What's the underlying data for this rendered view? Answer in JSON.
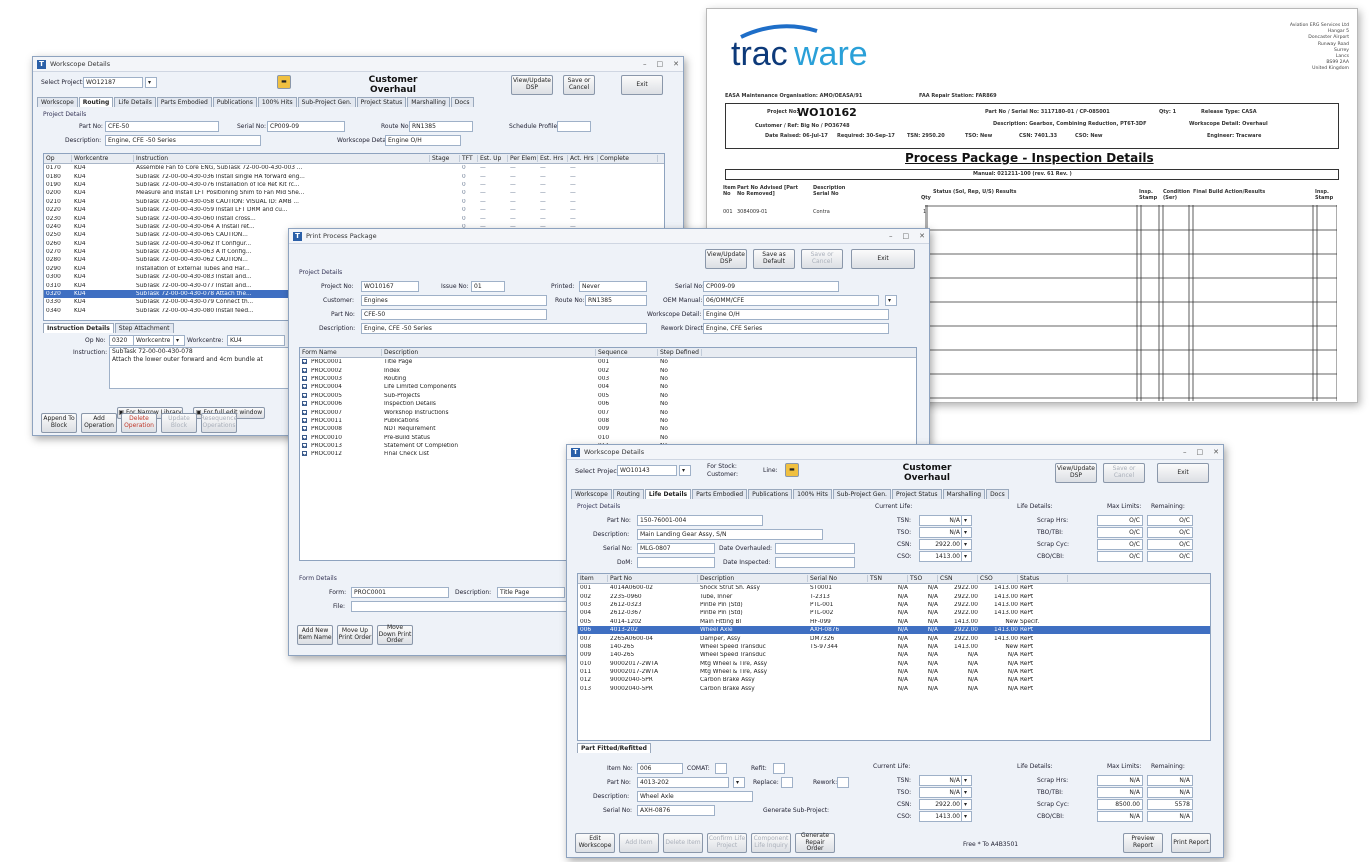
{
  "doc": {
    "logo_a": "trac",
    "logo_b": "ware",
    "company": [
      "Aviation ERG Services Ltd",
      "Hangar 5",
      "Doncaster Airport",
      "Runway Road",
      "Surrey",
      "Lancs",
      "BS99 2AA",
      "United Kingdom"
    ],
    "org_line": "EASA Maintenance Organisation: AMO/OEASA/91",
    "faa_line": "FAA Repair Station: FAR869",
    "project_label": "Project No:",
    "project_no": "WO10162",
    "customer": "Customer / Ref: Big No / PO36748",
    "date_raised": "Date Raised: 06-Jul-17",
    "required": "Required: 30-Sep-17",
    "part_serial": "Part No / Serial No: 3117180-01 / CP-085001",
    "description": "Description: Gearbox, Combining Reduction, PT6T-3DF",
    "tsn": "TSN: 2950.20",
    "tso": "TSO: New",
    "csn": "CSN: 7401.33",
    "cso": "CSO: New",
    "qty": "Qty: 1",
    "release_type": "Release Type: CASA",
    "workscope": "Workscope Detail: Overhaul",
    "engineer": "Engineer: Tracware",
    "heading": "Process Package - Inspection Details",
    "manual": "Manual: 021211-100 (rev. 61 Rev. )",
    "columns": [
      "Item No",
      "Part No Advised [Part No Removed]",
      "Description Serial No",
      "Qty",
      "Status (Sol, Rep, U/S) Results",
      "Insp. Stamp",
      "Condition (Ser)",
      "Final Build Action/Results",
      "Insp. Stamp"
    ],
    "row1": [
      "001",
      "3084009-01",
      "Contra",
      "1"
    ]
  },
  "win_routing": {
    "title": "Workscope Details",
    "select_project_label": "Select Project:",
    "select_project_value": "WO12187",
    "center_title": "Customer Overhaul",
    "btn_view": "View/Update DSP",
    "btn_save": "Save or Cancel",
    "btn_exit": "Exit",
    "tabs": [
      "Workscope",
      "Routing",
      "Life Details",
      "Parts Embodied",
      "Publications",
      "100% Hits",
      "Sub-Project Gen.",
      "Project Status",
      "Marshalling",
      "Docs"
    ],
    "active_tab": "Routing",
    "section": "Project Details",
    "part_no_label": "Part No:",
    "part_no": "CFE-50",
    "serial_label": "Serial No:",
    "serial": "CP009-09",
    "route_label": "Route No:",
    "route": "RN1385",
    "schedule_label": "Schedule Profile:",
    "description_label": "Description:",
    "description": "Engine, CFE -50 Series",
    "workscope_label": "Workscope Detail:",
    "workscope": "Engine O/H",
    "columns": [
      "Op",
      "Workcentre",
      "Instruction",
      "Stage",
      "TFT",
      "Est. Up",
      "Per Elem",
      "Est. Hrs",
      "Act. Hrs",
      "Complete"
    ],
    "rows": [
      [
        "0170",
        "KU4",
        "Assemble Fan to Core ENG, SubTask 72-00-00-430-003 ..."
      ],
      [
        "0180",
        "KU4",
        "SubTask 72-00-00-430-036 Install single HA forward eng..."
      ],
      [
        "0190",
        "KU4",
        "SubTask 72-00-00-430-076 Installation of Ice Ret Kit rc..."
      ],
      [
        "0200",
        "KU4",
        "Measure and Install LFT Positioning Shim to Fan Mid She..."
      ],
      [
        "0210",
        "KU4",
        "SubTask 72-00-00-430-058 CAUTION: VISUAL ID: AMB ..."
      ],
      [
        "0220",
        "KU4",
        "SubTask 72-00-00-430-059 Install LFT DRM and cu..."
      ],
      [
        "0230",
        "KU4",
        "SubTask 72-00-00-430-060 Install cross..."
      ],
      [
        "0240",
        "KU4",
        "SubTask 72-00-00-430-064 A Install ret..."
      ],
      [
        "0250",
        "KU4",
        "SubTask 72-00-00-430-065 CAUTION..."
      ],
      [
        "0260",
        "KU4",
        "SubTask 72-00-00-430-062 If Configur..."
      ],
      [
        "0270",
        "KU4",
        "SubTask 72-00-00-430-063 A If Config..."
      ],
      [
        "0280",
        "KU4",
        "SubTask 72-00-00-430-062 CAUTION..."
      ],
      [
        "0290",
        "KU4",
        "Installation of External Tubes and Har..."
      ],
      [
        "0300",
        "KU4",
        "SubTask 72-00-00-430-083 Install and..."
      ],
      [
        "0310",
        "KU4",
        "SubTask 72-00-00-430-077 Install and..."
      ],
      [
        "0320",
        "KU4",
        "SubTask 72-00-00-430-078 Attach the..."
      ],
      [
        "0330",
        "KU4",
        "SubTask 72-00-00-430-079 Connect th..."
      ],
      [
        "0340",
        "KU4",
        "SubTask 72-00-00-430-080 Install feed..."
      ]
    ],
    "status_vals": [
      "0",
      "—",
      "—",
      "—",
      "—"
    ],
    "sub_tabs": [
      "Instruction Details",
      "Step Attachment"
    ],
    "op_label": "Op No:",
    "op_value": "0320",
    "op_type": "Workcentre",
    "wc_label": "Workcentre:",
    "wc_value": "KU4",
    "instr_label": "Instruction:",
    "instr_1": "SubTask 72-00-00-430-078",
    "instr_2": "Attach the lower outer forward and 4cm bundle at",
    "lib_btn": "For Narrow Library",
    "edit_btn": "For full edit window",
    "bottom_btns": [
      "Append To Block",
      "Add Operation",
      "Delete Operation",
      "Update Block",
      "Resequence Operations"
    ]
  },
  "win_print": {
    "title": "Print Process Package",
    "btn_view": "View/Update DSP",
    "btn_default": "Save as Default",
    "btn_cancel": "Save or Cancel",
    "btn_exit": "Exit",
    "section": "Project Details",
    "project_label": "Project No:",
    "project": "WO10167",
    "issue_label": "Issue No:",
    "issue": "01",
    "printed_label": "Printed:",
    "printed": "Never",
    "serial_label": "Serial No:",
    "serial": "CP009-09",
    "customer_label": "Customer:",
    "customer": "Engines",
    "route_label": "Route No:",
    "route": "RN1385",
    "oem_label": "OEM Manual:",
    "oem": "06/OMM/CFE",
    "part_label": "Part No:",
    "part": "CFE-50",
    "workscope_label": "Workscope Detail:",
    "workscope": "Engine O/H",
    "desc_label": "Description:",
    "desc": "Engine, CFE -50 Series",
    "rework_label": "Rework Direct:",
    "rework": "Engine, CFE Series",
    "columns": [
      "Form Name",
      "Description",
      "Sequence",
      "Step Defined"
    ],
    "rows": [
      [
        "PROC0001",
        "Title Page",
        "001",
        "No"
      ],
      [
        "PROC0002",
        "Index",
        "002",
        "No"
      ],
      [
        "PROC0003",
        "Routing",
        "003",
        "No"
      ],
      [
        "PROC0004",
        "Life Limited Components",
        "004",
        "No"
      ],
      [
        "PROC0005",
        "Sub-Projects",
        "005",
        "No"
      ],
      [
        "PROC0006",
        "Inspection Details",
        "006",
        "No"
      ],
      [
        "PROC0007",
        "Workshop Instructions",
        "007",
        "No"
      ],
      [
        "PROC0011",
        "Publications",
        "008",
        "No"
      ],
      [
        "PROC0008",
        "NDT Requirement",
        "009",
        "No"
      ],
      [
        "PROC0010",
        "Pre-Build Status",
        "010",
        "No"
      ],
      [
        "PROC0013",
        "Statement Of Completion",
        "011",
        "No"
      ],
      [
        "PROC0012",
        "Final Check List",
        "012",
        "No"
      ]
    ],
    "form_section": "Form Details",
    "form_label": "Form:",
    "form": "PROC0001",
    "form_desc_label": "Description:",
    "form_desc": "Title Page",
    "file_label": "File:",
    "bottom_btns": [
      "Add New Item Name",
      "Move Up Print Order",
      "Move Down Print Order"
    ]
  },
  "win_life": {
    "title": "Workscope Details",
    "select_project_label": "Select Project:",
    "select_project_value": "WO10143",
    "for_stock": "For Stock:",
    "customer_q": "Customer:",
    "line_label": "Line:",
    "center_title": "Customer Overhaul",
    "btn_view": "View/Update DSP",
    "btn_save": "Save or Cancel",
    "btn_exit": "Exit",
    "tabs": [
      "Workscope",
      "Routing",
      "Life Details",
      "Parts Embodied",
      "Publications",
      "100% Hits",
      "Sub-Project Gen.",
      "Project Status",
      "Marshalling",
      "Docs"
    ],
    "active_tab": "Life Details",
    "section": "Project Details",
    "part_label": "Part No:",
    "part": "150-76001-004",
    "desc_label": "Description:",
    "desc": "Main Landing Gear Assy, S/N",
    "serial_label": "Serial No:",
    "serial": "MLG-0807",
    "dom_label": "DoM:",
    "overhauled_label": "Date Overhauled:",
    "inspected_label": "Date Inspected:",
    "current_life": "Current Life:",
    "life_details": "Life Details:",
    "max_limits": "Max Limits:",
    "remaining": "Remaining:",
    "cur": [
      [
        "TSN:",
        "N/A"
      ],
      [
        "TSO:",
        "N/A"
      ],
      [
        "CSN:",
        "2922.00"
      ],
      [
        "CSO:",
        "1413.00"
      ]
    ],
    "ld": [
      [
        "Scrap Hrs:",
        "O/C",
        "O/C"
      ],
      [
        "TBO/TBI:",
        "O/C",
        "O/C"
      ],
      [
        "Scrap Cyc:",
        "O/C",
        "O/C"
      ],
      [
        "CBO/CBI:",
        "O/C",
        "O/C"
      ]
    ],
    "columns": [
      "Item",
      "Part No",
      "Description",
      "Serial No",
      "TSN",
      "TSO",
      "CSN",
      "CSO",
      "Status"
    ],
    "rows": [
      [
        "001",
        "4014A0600-02",
        "Shock Strut Sh. Assy",
        "ST0001",
        "N/A",
        "N/A",
        "2922.00",
        "1413.00",
        "RePt"
      ],
      [
        "002",
        "2235-0960",
        "Tube, Inner",
        "T-2313",
        "N/A",
        "N/A",
        "2922.00",
        "1413.00",
        "RePt"
      ],
      [
        "003",
        "2612-0323",
        "Pintle Pin (Std)",
        "PTL-001",
        "N/A",
        "N/A",
        "2922.00",
        "1413.00",
        "RePt"
      ],
      [
        "004",
        "2612-0367",
        "Pintle Pin (Std)",
        "PTL-002",
        "N/A",
        "N/A",
        "2922.00",
        "1413.00",
        "RePt"
      ],
      [
        "005",
        "4014-1202",
        "Main Fitting Bl",
        "HF-099",
        "N/A",
        "N/A",
        "1413.00",
        "New",
        "Specif."
      ],
      [
        "006",
        "4013-202",
        "Wheel Axle",
        "AXH-0876",
        "N/A",
        "N/A",
        "2922.00",
        "1413.00",
        "RePt"
      ],
      [
        "007",
        "2265A0600-04",
        "Damper, Assy",
        "DM7326",
        "N/A",
        "N/A",
        "2922.00",
        "1413.00",
        "RePt"
      ],
      [
        "008",
        "140-265",
        "Wheel Speed Transduc",
        "TS-97344",
        "N/A",
        "N/A",
        "1413.00",
        "New",
        "RePt"
      ],
      [
        "009",
        "140-265",
        "Wheel Speed Transduc",
        "",
        "N/A",
        "N/A",
        "N/A",
        "N/A",
        "RePt"
      ],
      [
        "010",
        "90002017-2WTA",
        "Mtg Wheel & Tire, Assy",
        "",
        "N/A",
        "N/A",
        "N/A",
        "N/A",
        "RePt"
      ],
      [
        "011",
        "90002017-2WTA",
        "Mtg Wheel & Tire, Assy",
        "",
        "N/A",
        "N/A",
        "N/A",
        "N/A",
        "RePt"
      ],
      [
        "012",
        "90002040-5PR",
        "Carbon Brake Assy",
        "",
        "N/A",
        "N/A",
        "N/A",
        "N/A",
        "RePt"
      ],
      [
        "013",
        "90002040-5PR",
        "Carbon Brake Assy",
        "",
        "N/A",
        "N/A",
        "N/A",
        "N/A",
        "RePt"
      ]
    ],
    "sub_tab": "Part Fitted/Refitted",
    "item_label": "Item No:",
    "item": "006",
    "comat_label": "COMAT:",
    "refit_label": "Refit:",
    "part_no_label": "Part No:",
    "part_no": "4013-202",
    "replace_label": "Replace:",
    "rework_label": "Rework:",
    "ds_label": "Description:",
    "ds": "Wheel Axle",
    "sn_label": "Serial No:",
    "sn": "AXH-0876",
    "gen_label": "Generate Sub-Project:",
    "cur2": [
      [
        "TSN:",
        "N/A"
      ],
      [
        "TSO:",
        "N/A"
      ],
      [
        "CSN:",
        "2922.00"
      ],
      [
        "CSO:",
        "1413.00"
      ]
    ],
    "ld2": [
      [
        "Scrap Hrs:",
        "N/A",
        "N/A"
      ],
      [
        "TBO/TBI:",
        "N/A",
        "N/A"
      ],
      [
        "Scrap Cyc:",
        "8500.00",
        "5578"
      ],
      [
        "CBO/CBI:",
        "N/A",
        "N/A"
      ]
    ],
    "bottom_btns": [
      "Edit Workscope",
      "Add Item",
      "Delete Item",
      "Confirm Life Project",
      "Component Life Inquiry",
      "Generate Repair Order"
    ],
    "footer_text": "Free * To A4B3501",
    "bottom_right": [
      "Preview Report",
      "Print Report"
    ]
  }
}
